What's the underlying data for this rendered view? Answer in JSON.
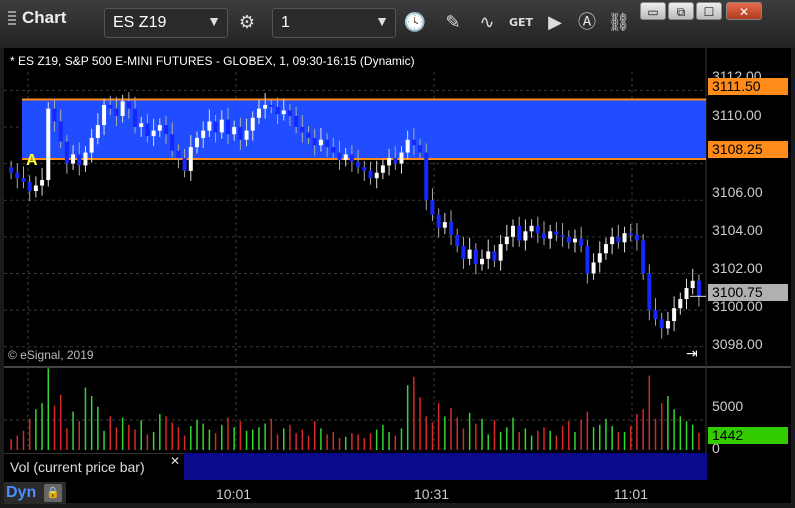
{
  "window": {
    "title": "Chart",
    "symbol": "ES Z19",
    "interval": "1",
    "buttons": {
      "minimize": "▭",
      "restore": "⧉",
      "maximize": "☐",
      "close": "✕"
    }
  },
  "toolbar_icons": [
    "settings-icon",
    "clock-icon",
    "pencil-icon",
    "study-icon",
    "get-icon",
    "play-icon",
    "alert-icon",
    "link-icon"
  ],
  "chart": {
    "header": "* ES Z19, S&P 500 E-MINI FUTURES - GLOBEX, 1, 09:30-16:15 (Dynamic)",
    "copyright": "© eSignal, 2019",
    "marker_label": "A",
    "price_labels": [
      "3112.00",
      "3110.00",
      "3106.00",
      "3104.00",
      "3102.00",
      "3100.00",
      "3098.00"
    ],
    "tags": {
      "upper": "3111.50",
      "lower": "3108.25",
      "last": "3100.75"
    },
    "volume_labels": {
      "top": "5000",
      "zero": "0",
      "current": "1442"
    },
    "time_labels": [
      "10:01",
      "10:31",
      "11:01"
    ],
    "study_label": "Vol (current price bar)",
    "dyn_label": "Dyn",
    "colors": {
      "zone": "#1f4dff",
      "zone_line": "#ff8c1a",
      "up": "#ffffff",
      "down": "#1428ff",
      "vol_up": "#33d633",
      "vol_down": "#d62a2a",
      "last_tag": "#b0b0b0",
      "vol_tag": "#33cc00"
    }
  },
  "chart_data": {
    "type": "candlestick",
    "y_range": [
      3097,
      3113
    ],
    "zone": [
      3108.25,
      3111.5
    ],
    "last": 3100.75,
    "closes": [
      3107.5,
      3107.2,
      3107.0,
      3106.5,
      3106.8,
      3107.1,
      3111.0,
      3110.3,
      3109.2,
      3108.0,
      3108.5,
      3107.9,
      3108.6,
      3109.4,
      3110.1,
      3111.2,
      3111.0,
      3110.6,
      3111.4,
      3111.0,
      3110.0,
      3110.2,
      3109.5,
      3109.8,
      3110.1,
      3109.6,
      3108.7,
      3108.3,
      3107.6,
      3108.9,
      3109.4,
      3109.8,
      3110.3,
      3109.7,
      3110.4,
      3109.6,
      3110.0,
      3109.3,
      3109.8,
      3110.5,
      3111.0,
      3111.2,
      3111.1,
      3110.7,
      3110.9,
      3110.6,
      3110.0,
      3109.7,
      3109.4,
      3109.0,
      3109.3,
      3108.9,
      3108.6,
      3108.2,
      3108.5,
      3108.1,
      3107.8,
      3107.6,
      3107.2,
      3107.5,
      3107.9,
      3108.3,
      3108.0,
      3108.6,
      3109.3,
      3109.0,
      3108.6,
      3106.0,
      3105.2,
      3104.5,
      3104.8,
      3104.1,
      3103.5,
      3102.8,
      3103.3,
      3102.5,
      3102.8,
      3103.2,
      3102.7,
      3103.6,
      3104.0,
      3104.6,
      3103.8,
      3104.3,
      3104.6,
      3104.2,
      3103.9,
      3104.3,
      3104.1,
      3104.0,
      3103.7,
      3103.9,
      3103.5,
      3102.0,
      3102.6,
      3103.1,
      3103.6,
      3104.0,
      3103.7,
      3104.2,
      3104.1,
      3103.8,
      3102.0,
      3100.0,
      3099.5,
      3099.0,
      3099.4,
      3100.1,
      3100.6,
      3101.2,
      3101.6,
      3100.75
    ],
    "volumes": [
      900,
      1200,
      1600,
      2600,
      3400,
      3900,
      6800,
      3700,
      4600,
      1800,
      3200,
      2400,
      5200,
      4500,
      3600,
      1600,
      2800,
      1900,
      2700,
      2100,
      1700,
      2500,
      1300,
      1500,
      3000,
      2800,
      2300,
      1900,
      1200,
      2000,
      2500,
      2200,
      1700,
      1400,
      2100,
      2700,
      1900,
      2400,
      1600,
      1700,
      1900,
      2200,
      2600,
      1300,
      1800,
      2100,
      1400,
      1700,
      1200,
      2400,
      1800,
      1300,
      1500,
      1000,
      1100,
      1400,
      1300,
      1000,
      1400,
      1700,
      2100,
      1500,
      1200,
      1800,
      5400,
      6100,
      4400,
      2800,
      2300,
      3900,
      2800,
      3500,
      2700,
      1800,
      3100,
      2200,
      2600,
      1300,
      2500,
      1500,
      1900,
      2700,
      1500,
      1800,
      1200,
      1600,
      1900,
      1600,
      1200,
      2000,
      2400,
      1500,
      2500,
      3200,
      1900,
      2100,
      2600,
      2000,
      1500,
      1500,
      2000,
      3000,
      3400,
      6200,
      2600,
      3900,
      4500,
      3400,
      2800,
      2400,
      2100,
      1442
    ]
  }
}
